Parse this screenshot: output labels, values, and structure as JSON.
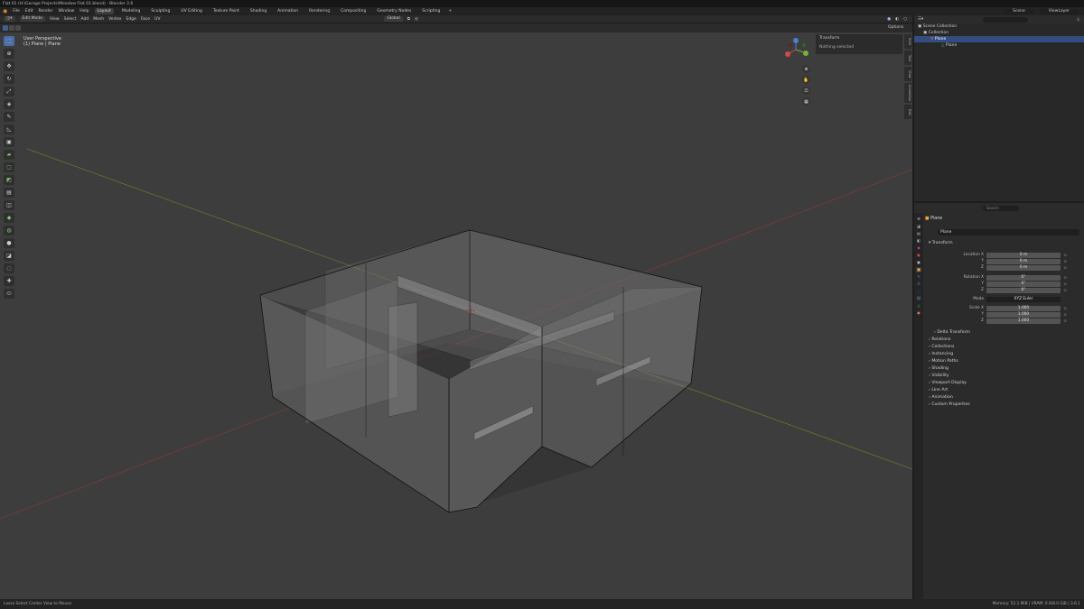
{
  "window_title": "Flat 01 (H:\\Garage Projects\\Meadow Flat 01.blend) - Blender 3.6",
  "menu": [
    "File",
    "Edit",
    "Render",
    "Window",
    "Help"
  ],
  "workspaces": [
    "Layout",
    "Modeling",
    "Sculpting",
    "UV Editing",
    "Texture Paint",
    "Shading",
    "Animation",
    "Rendering",
    "Compositing",
    "Geometry Nodes",
    "Scripting"
  ],
  "active_workspace": "Layout",
  "scene": "Scene",
  "view_layer": "ViewLayer",
  "header3d": {
    "mode": "Edit Mode",
    "menus": [
      "View",
      "Select",
      "Add",
      "Mesh",
      "Vertex",
      "Edge",
      "Face",
      "UV"
    ],
    "orientation": "Global",
    "options": "Options"
  },
  "viewport": {
    "line1": "User Perspective",
    "line2": "(1) Plane | Plane"
  },
  "npanel": {
    "header": "Transform",
    "body": "Nothing selected",
    "tabs": [
      "Item",
      "Tool",
      "View",
      "Animation",
      "Edit"
    ]
  },
  "tools": [
    "select",
    "cursor",
    "move",
    "rotate",
    "scale",
    "transform",
    "annotate",
    "measure",
    "add-cube",
    "extrude",
    "inset",
    "bevel",
    "loop-cut",
    "knife",
    "poly-build",
    "spin",
    "smooth",
    "edge-slide",
    "shrink",
    "shear",
    "rip"
  ],
  "outliner": {
    "search_placeholder": "",
    "rows": [
      "Scene Collection",
      "Collection",
      "Plane",
      "Plane"
    ]
  },
  "properties": {
    "search_placeholder": "Search",
    "object_name": "Plane",
    "datablock_name": "Plane",
    "transform_label": "Transform",
    "location": {
      "label_x": "Location X",
      "label_y": "Y",
      "label_z": "Z",
      "x": "0 m",
      "y": "0 m",
      "z": "0 m"
    },
    "rotation": {
      "label_x": "Rotation X",
      "label_y": "Y",
      "label_z": "Z",
      "x": "0°",
      "y": "0°",
      "z": "0°"
    },
    "mode": {
      "label": "Mode",
      "value": "XYZ Euler"
    },
    "scale": {
      "label_x": "Scale X",
      "label_y": "Y",
      "label_z": "Z",
      "x": "1.000",
      "y": "1.000",
      "z": "1.000"
    },
    "sections": [
      "Delta Transform",
      "Relations",
      "Collections",
      "Instancing",
      "Motion Paths",
      "Shading",
      "Visibility",
      "Viewport Display",
      "Line Art",
      "Animation",
      "Custom Properties"
    ]
  },
  "status": {
    "left": "Lasso Select   Center View to Mouse",
    "right": "Memory: 52.1 MiB | VRAM: 0.9/8.0 GiB | 3.6.1"
  },
  "colors": {
    "accent": "#4a6ea9",
    "viewport_bg": "#3d3d3d",
    "x_axis": "#8a3434",
    "y_axis": "#7b8a2f",
    "selection_blue": "#334d80"
  }
}
